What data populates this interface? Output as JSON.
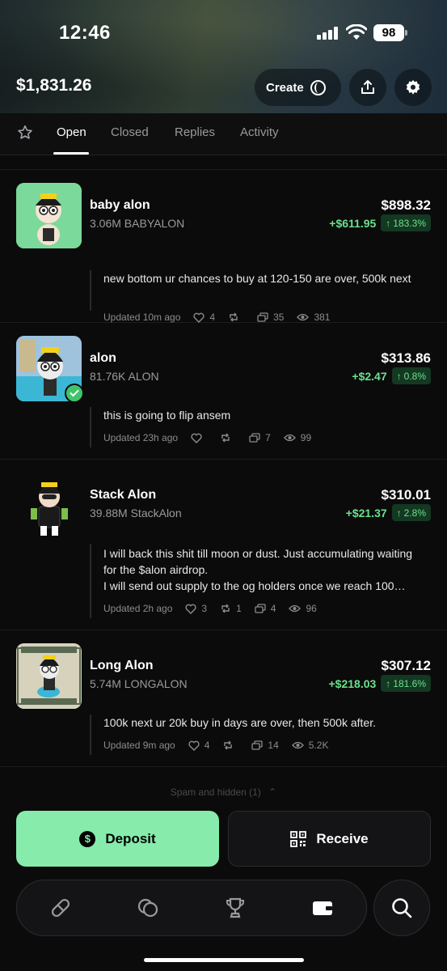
{
  "status_bar": {
    "time": "12:46",
    "battery": "98"
  },
  "header": {
    "balance": "$1,831.26",
    "create_label": "Create"
  },
  "tabs": [
    {
      "label": "Open",
      "active": true
    },
    {
      "label": "Closed",
      "active": false
    },
    {
      "label": "Replies",
      "active": false
    },
    {
      "label": "Activity",
      "active": false
    }
  ],
  "positions": [
    {
      "name": "baby alon",
      "holding": "3.06M BABYALON",
      "value": "$898.32",
      "pnl": "+$611.95",
      "pnl_pct": "183.3%",
      "reply": "new bottom ur chances to buy at 120-150 are over, 500k next",
      "updated": "Updated 10m ago",
      "likes": "4",
      "reposts": "",
      "comments": "35",
      "views": "381"
    },
    {
      "name": "alon",
      "holding": "81.76K ALON",
      "value": "$313.86",
      "pnl": "+$2.47",
      "pnl_pct": "0.8%",
      "reply": "this is going to flip ansem",
      "updated": "Updated 23h ago",
      "likes": "",
      "reposts": "",
      "comments": "7",
      "views": "99"
    },
    {
      "name": "Stack Alon",
      "holding": "39.88M StackAlon",
      "value": "$310.01",
      "pnl": "+$21.37",
      "pnl_pct": "2.8%",
      "reply": "I will back this shit till moon or dust. Just accumulating waiting for the $alon airdrop.",
      "reply2": "I will send out supply to the og holders once we reach 100…",
      "updated": "Updated 2h ago",
      "likes": "3",
      "reposts": "1",
      "comments": "4",
      "views": "96"
    },
    {
      "name": "Long Alon",
      "holding": "5.74M LONGALON",
      "value": "$307.12",
      "pnl": "+$218.03",
      "pnl_pct": "181.6%",
      "reply": "100k next ur 20k buy in days are over, then 500k after.",
      "updated": "Updated 9m ago",
      "likes": "4",
      "reposts": "",
      "comments": "14",
      "views": "5.2K"
    }
  ],
  "spam_label": "Spam and hidden (1)",
  "actions": {
    "deposit_label": "Deposit",
    "receive_label": "Receive"
  },
  "nav": {
    "icons": [
      "pill-icon",
      "coins-icon",
      "trophy-icon",
      "wallet-icon",
      "search-icon"
    ]
  },
  "colors": {
    "accent": "#86ebab",
    "positive": "#6be18c",
    "background": "#0b0b0c"
  }
}
